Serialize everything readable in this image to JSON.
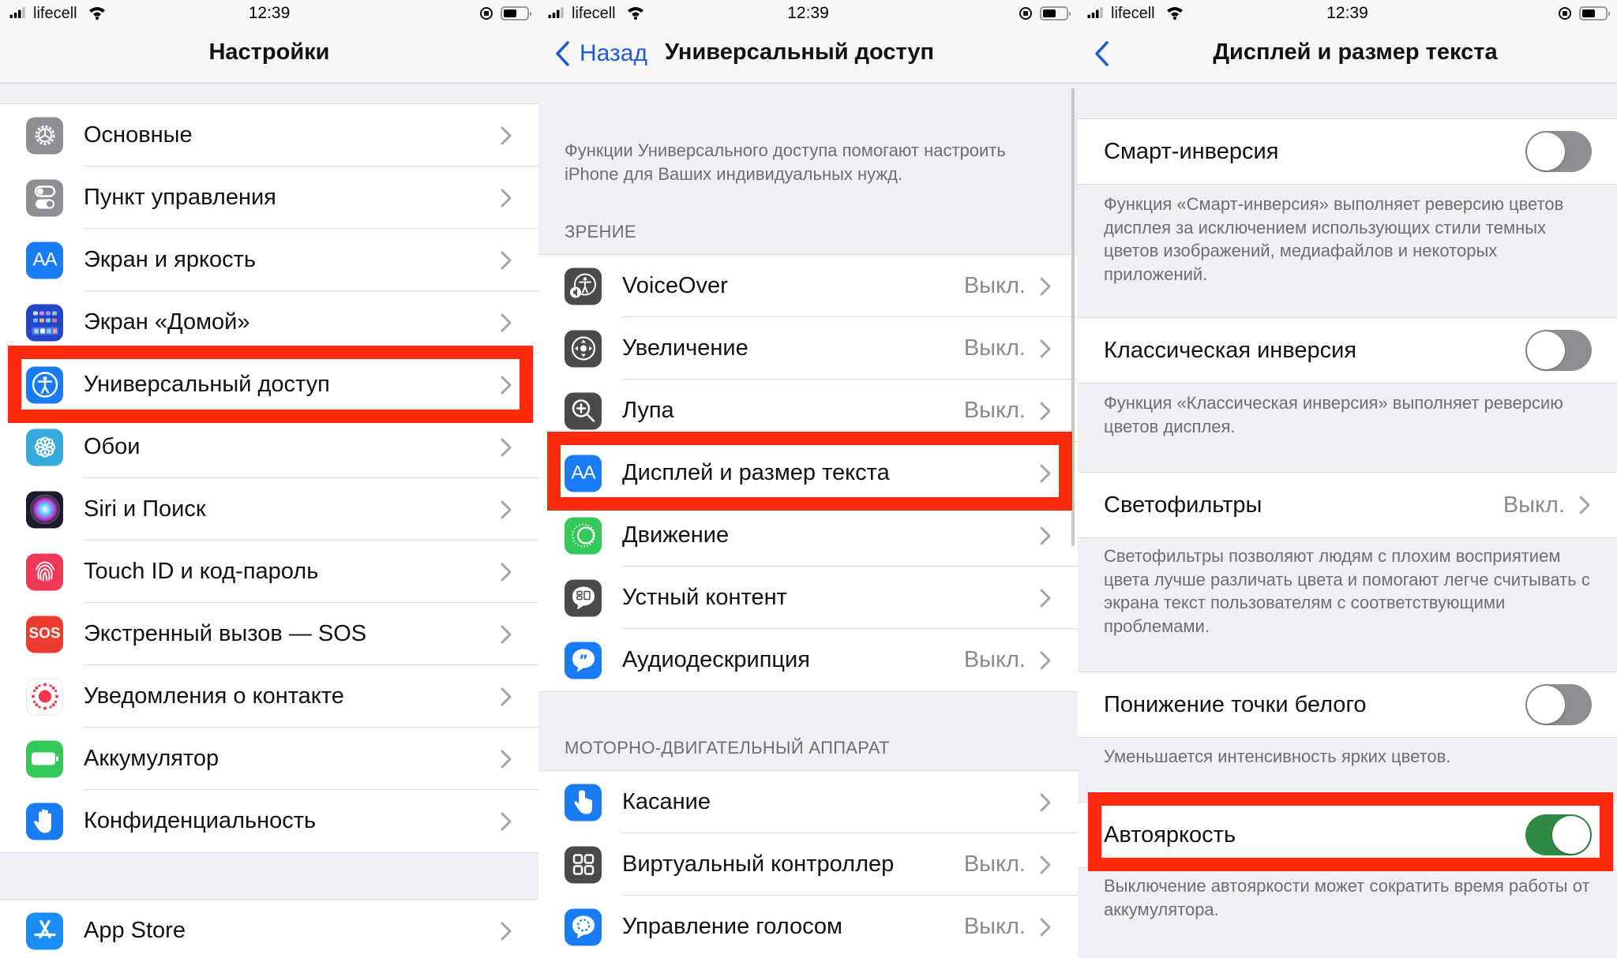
{
  "status_bar": {
    "carrier": "lifecell",
    "time": "12:39"
  },
  "panel1": {
    "title": "Настройки",
    "items": [
      {
        "label": "Основные",
        "icon": "gear-icon",
        "color": "#8e8e93"
      },
      {
        "label": "Пункт управления",
        "icon": "control-center-icon",
        "color": "#8e8e93"
      },
      {
        "label": "Экран и яркость",
        "icon": "display-brightness-icon",
        "color": "#1a7cf5"
      },
      {
        "label": "Экран «Домой»",
        "icon": "home-screen-icon",
        "color": "#2346c8"
      },
      {
        "label": "Универсальный доступ",
        "icon": "accessibility-icon",
        "color": "#1a7cf5"
      },
      {
        "label": "Обои",
        "icon": "wallpaper-icon",
        "color": "#36aadc"
      },
      {
        "label": "Siri и Поиск",
        "icon": "siri-icon",
        "color": "#1c1c2e"
      },
      {
        "label": "Touch ID и код-пароль",
        "icon": "fingerprint-icon",
        "color": "#f0385a"
      },
      {
        "label": "Экстренный вызов — SOS",
        "icon": "sos-icon",
        "color": "#ee3b30",
        "text": "SOS"
      },
      {
        "label": "Уведомления о контакте",
        "icon": "exposure-notification-icon",
        "color": "#ffffff"
      },
      {
        "label": "Аккумулятор",
        "icon": "battery-icon",
        "color": "#34c759"
      },
      {
        "label": "Конфиденциальность",
        "icon": "privacy-hand-icon",
        "color": "#1a7cf5"
      }
    ],
    "app_store": {
      "label": "App Store",
      "icon": "app-store-icon",
      "color": "#1a8cf5"
    }
  },
  "panel2": {
    "back_label": "Назад",
    "title": "Универсальный доступ",
    "description": "Функции Универсального доступа помогают настроить iPhone для Ваших индивидуальных нужд.",
    "section_vision": "ЗРЕНИЕ",
    "vision_items": [
      {
        "label": "VoiceOver",
        "value": "Выкл.",
        "icon": "voiceover-icon",
        "color": "#4a4a4c"
      },
      {
        "label": "Увеличение",
        "value": "Выкл.",
        "icon": "zoom-icon",
        "color": "#4a4a4c"
      },
      {
        "label": "Лупа",
        "value": "Выкл.",
        "icon": "magnifier-icon",
        "color": "#4a4a4c"
      },
      {
        "label": "Дисплей и размер текста",
        "value": "",
        "icon": "display-text-size-icon",
        "color": "#1a7cf5"
      },
      {
        "label": "Движение",
        "value": "",
        "icon": "motion-icon",
        "color": "#34c759"
      },
      {
        "label": "Устный контент",
        "value": "",
        "icon": "spoken-content-icon",
        "color": "#4a4a4c"
      },
      {
        "label": "Аудиодескрипция",
        "value": "Выкл.",
        "icon": "audio-description-icon",
        "color": "#1a7cf5"
      }
    ],
    "section_motor": "МОТОРНО-ДВИГАТЕЛЬНЫЙ АППАРАТ",
    "motor_items": [
      {
        "label": "Касание",
        "value": "",
        "icon": "touch-icon",
        "color": "#1a7cf5"
      },
      {
        "label": "Виртуальный контроллер",
        "value": "Выкл.",
        "icon": "switch-control-icon",
        "color": "#4a4a4c"
      },
      {
        "label": "Управление голосом",
        "value": "Выкл.",
        "icon": "voice-control-icon",
        "color": "#1a7cf5"
      }
    ]
  },
  "panel3": {
    "title": "Дисплей и размер текста",
    "settings": [
      {
        "label": "Смарт-инверсия",
        "type": "toggle",
        "on": false,
        "description": "Функция «Смарт-инверсия» выполняет реверсию цветов дисплея за исключением использующих стили темных цветов изображений, медиафайлов и некоторых приложений."
      },
      {
        "label": "Классическая инверсия",
        "type": "toggle",
        "on": false,
        "description": "Функция «Классическая инверсия» выполняет реверсию цветов дисплея."
      },
      {
        "label": "Светофильтры",
        "type": "link",
        "value": "Выкл.",
        "description": "Светофильтры позволяют людям с плохим восприятием цвета лучше различать цвета и помогают легче считывать с экрана текст пользователям с соответствующими проблемами."
      },
      {
        "label": "Понижение точки белого",
        "type": "toggle",
        "on": false,
        "description": "Уменьшается интенсивность ярких цветов."
      },
      {
        "label": "Автояркость",
        "type": "toggle",
        "on": true,
        "description": "Выключение автояркости может сократить время работы от аккумулятора."
      }
    ]
  },
  "colors": {
    "highlight": "#fe2a0e",
    "toggle_on": "#2e8b45",
    "toggle_off": "#8e8e93",
    "link_blue": "#1e5bd6"
  }
}
